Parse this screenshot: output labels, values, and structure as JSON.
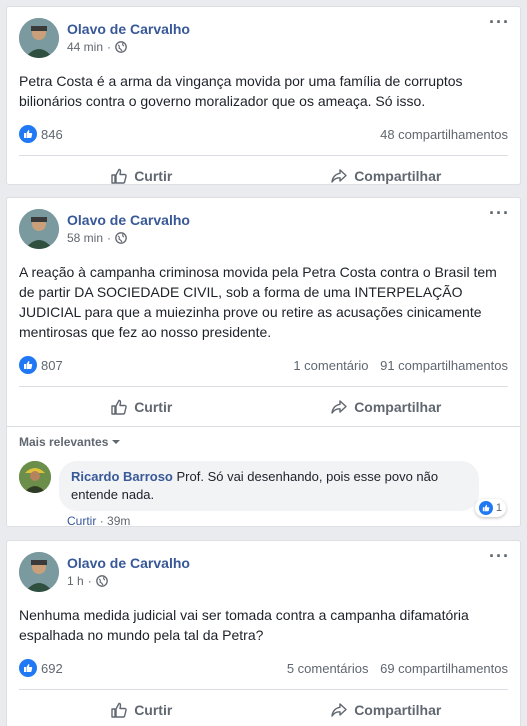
{
  "posts": [
    {
      "author": "Olavo de Carvalho",
      "time": "44 min",
      "text": "Petra Costa é a arma da vingança movida por uma família de corruptos bilionários contra o governo moralizador que os ameaça. Só isso.",
      "likes": "846",
      "comments": "",
      "shares": "48 compartilhamentos",
      "like_label": "Curtir",
      "share_label": "Compartilhar"
    },
    {
      "author": "Olavo de Carvalho",
      "time": "58 min",
      "text": "A reação à campanha criminosa movida pela Petra Costa contra o Brasil tem de partir DA SOCIEDADE CIVIL, sob a forma de uma INTERPELAÇÃO JUDICIAL para que a muiezinha prove ou retire as acusações cinicamente mentirosas que fez ao nosso presidente.",
      "likes": "807",
      "comments": "1 comentário",
      "shares": "91 compartilhamentos",
      "like_label": "Curtir",
      "share_label": "Compartilhar",
      "comment_sort": "Mais relevantes",
      "comment": {
        "author": "Ricardo Barroso",
        "text": "Prof. Só vai desenhando, pois esse povo não entende nada.",
        "like_count": "1",
        "like_action": "Curtir",
        "time": "39m"
      }
    },
    {
      "author": "Olavo de Carvalho",
      "time": "1 h",
      "text": "Nenhuma medida judicial vai ser tomada contra a campanha difamatória espalhada no mundo pela tal da Petra?",
      "likes": "692",
      "comments": "5 comentários",
      "shares": "69 compartilhamentos",
      "like_label": "Curtir",
      "share_label": "Compartilhar"
    }
  ],
  "meta_separator": "·",
  "more_icon": "···",
  "colors": {
    "author": "#385898",
    "like_badge": "#2078f4",
    "background": "#e9ebee"
  }
}
